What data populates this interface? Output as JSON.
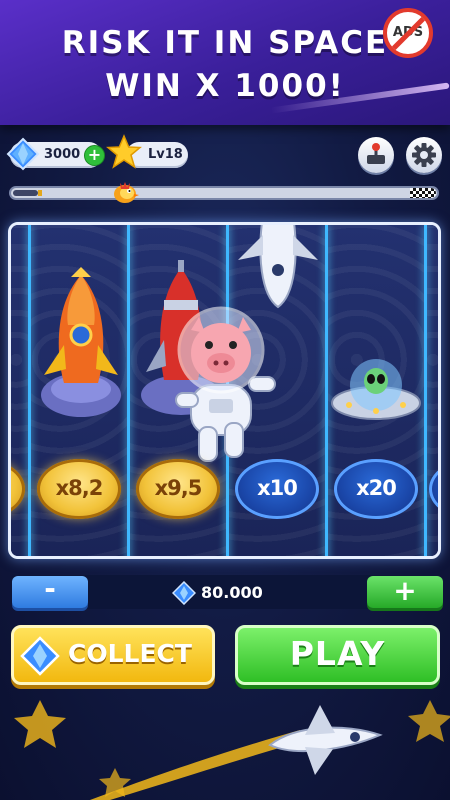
{
  "promo": {
    "line1": "RISK IT IN SPACE",
    "line2": "WIN X 1000!",
    "no_ads_label": "ADS"
  },
  "header": {
    "gems": "3000",
    "level": "Lv18"
  },
  "progress": {
    "fraction": 0.06
  },
  "board": {
    "multipliers": [
      {
        "label": "x8,2",
        "style": "gold"
      },
      {
        "label": "x9,5",
        "style": "gold"
      },
      {
        "label": "x10",
        "style": "blue"
      },
      {
        "label": "x20",
        "style": "blue"
      }
    ],
    "symbols": [
      "rocket-orange",
      "rocket-red",
      "space-shuttle",
      "ufo-alien",
      "pig-astronaut"
    ]
  },
  "bet": {
    "minus_label": "-",
    "plus_label": "+",
    "amount": "80.000"
  },
  "actions": {
    "collect_label": "COLLECT",
    "play_label": "PLAY"
  },
  "colors": {
    "lane_glow": "#3fb8ff",
    "collect": "#f2b80f",
    "play": "#2fbf26",
    "banner": "#3a1f9a"
  }
}
